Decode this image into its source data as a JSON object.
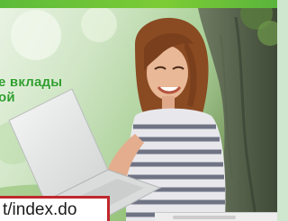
{
  "banner": {
    "promo_line1": "е вклады",
    "promo_line2": "ой",
    "image_alt": "woman-with-laptop-photo"
  },
  "address_bar": {
    "url_fragment": "t/index.do"
  },
  "colors": {
    "accent_green": "#2f9e2c",
    "highlight_red": "#c0272d",
    "top_strip_green": "#6cc23a"
  }
}
